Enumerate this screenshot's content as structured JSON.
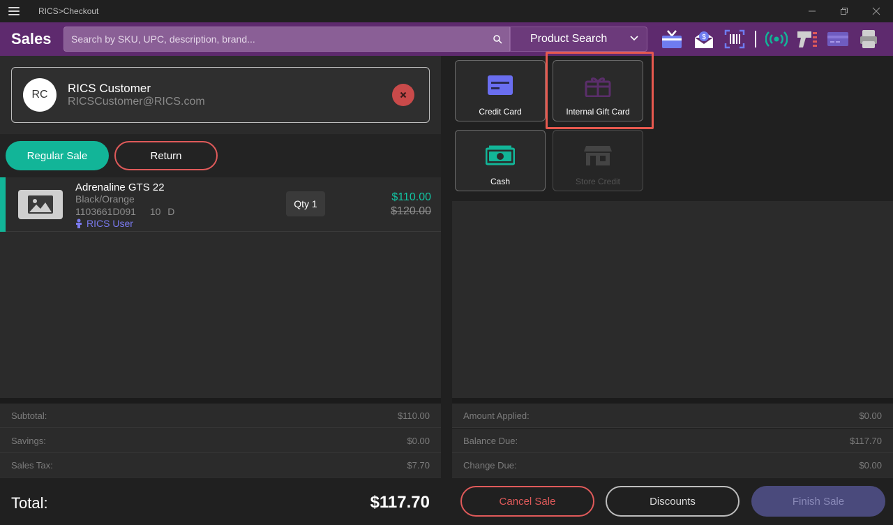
{
  "window": {
    "title": "RICS>Checkout",
    "menu_icon": "hamburger-icon",
    "controls": [
      "minimize-icon",
      "restore-icon",
      "close-icon"
    ]
  },
  "header": {
    "title": "Sales",
    "search_placeholder": "Search by SKU, UPC, description, brand...",
    "search_mode": "Product Search",
    "icons": [
      "gift-card-icon",
      "email-receipt-icon",
      "barcode-scan-icon",
      "rfid-icon",
      "scanner-gun-icon",
      "card-reader-icon",
      "printer-icon"
    ],
    "accent": "#5e2a6e"
  },
  "customer": {
    "initials": "RC",
    "name": "RICS Customer",
    "email": "RICSCustomer@RICS.com"
  },
  "sale_mode": {
    "regular": "Regular Sale",
    "return": "Return",
    "selected": "Regular Sale"
  },
  "line_items": [
    {
      "name": "Adrenaline GTS 22",
      "color": "Black/Orange",
      "sku": "1103661D091",
      "size": "10",
      "width": "D",
      "user": "RICS User",
      "qty": "Qty 1",
      "price": "$110.00",
      "original_price": "$120.00"
    }
  ],
  "totals": {
    "subtotal_label": "Subtotal:",
    "subtotal": "$110.00",
    "savings_label": "Savings:",
    "savings": "$0.00",
    "tax_label": "Sales Tax:",
    "tax": "$7.70",
    "total_label": "Total:",
    "total": "$117.70"
  },
  "tenders": [
    {
      "label": "Credit Card",
      "icon": "credit-card-icon",
      "enabled": true
    },
    {
      "label": "Internal Gift Card",
      "icon": "gift-icon",
      "enabled": true,
      "highlighted": true
    },
    {
      "label": "Cash",
      "icon": "cash-icon",
      "enabled": true
    },
    {
      "label": "Store Credit",
      "icon": "store-icon",
      "enabled": false
    }
  ],
  "payment": {
    "applied_label": "Amount Applied:",
    "applied": "$0.00",
    "balance_label": "Balance Due:",
    "balance": "$117.70",
    "change_label": "Change Due:",
    "change": "$0.00"
  },
  "actions": {
    "cancel": "Cancel Sale",
    "discounts": "Discounts",
    "finish": "Finish Sale"
  },
  "colors": {
    "teal": "#12b598",
    "red": "#e05a5a",
    "highlight": "#e8594f"
  }
}
